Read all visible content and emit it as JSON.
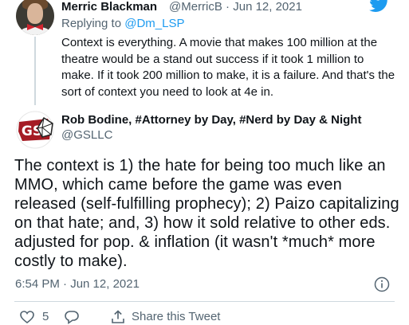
{
  "reply_tweet": {
    "author_name": "Merric Blackman",
    "handle_date": "@MerricB · Jun 12, 2021",
    "replying_prefix": "Replying to ",
    "replying_to": "@Dm_LSP",
    "text": "Context is everything. A movie that makes 100 million at the theatre would be a stand out success if it took 1 million to make. If it took 200 million to make, it is a failure. And that's the sort of context you need to look at 4e in."
  },
  "main_tweet": {
    "author_name": "Rob Bodine, #Attorney by Day, #Nerd by Day & Night",
    "handle": "@GSLLC",
    "avatar_text": "GS",
    "text": "The context is 1) the hate for being too much like an MMO, which came before the game was even released (self-fulfilling prophecy); 2) Paizo capitalizing on that hate; and, 3) how it sold relative to other eds. adjusted for pop. & inflation (it wasn't *much* more costly to make).",
    "timestamp": "6:54 PM · Jun 12, 2021"
  },
  "actions": {
    "like_count": "5",
    "share_label": "Share this Tweet"
  },
  "icons": {
    "brand": "twitter-bird-icon",
    "info": "info-icon",
    "like": "heart-icon",
    "reply": "comment-icon",
    "share": "share-icon"
  },
  "colors": {
    "accent": "#1d9bf0",
    "text": "#0f1419",
    "secondary": "#536471",
    "avatar2_red": "#a51b24"
  }
}
